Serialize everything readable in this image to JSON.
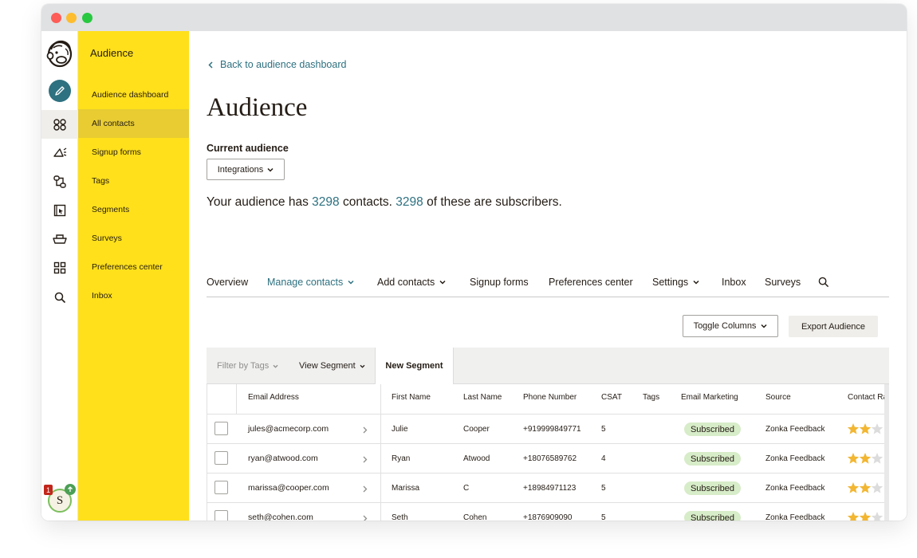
{
  "app": {
    "sidebar_title": "Audience",
    "avatar_initial": "S",
    "notification_count": "1"
  },
  "sidebar": {
    "items": [
      {
        "label": "Audience dashboard"
      },
      {
        "label": "All contacts"
      },
      {
        "label": "Signup forms"
      },
      {
        "label": "Tags"
      },
      {
        "label": "Segments"
      },
      {
        "label": "Surveys"
      },
      {
        "label": "Preferences center"
      },
      {
        "label": "Inbox"
      }
    ]
  },
  "header": {
    "back_link": "Back to audience dashboard",
    "title": "Audience",
    "current_audience_label": "Current audience",
    "audience_dropdown": "Integrations",
    "summary": {
      "prefix": "Your audience has ",
      "contacts": "3298",
      "middle": " contacts. ",
      "subscribers": "3298",
      "suffix": " of these are subscribers."
    }
  },
  "tabs": [
    {
      "label": "Overview"
    },
    {
      "label": "Manage contacts"
    },
    {
      "label": "Add contacts"
    },
    {
      "label": "Signup forms"
    },
    {
      "label": "Preferences center"
    },
    {
      "label": "Settings"
    },
    {
      "label": "Inbox"
    },
    {
      "label": "Surveys"
    }
  ],
  "actions": {
    "toggle_columns": "Toggle Columns",
    "export": "Export Audience"
  },
  "filters": {
    "filter_by_tags": "Filter by Tags",
    "view_segment": "View Segment",
    "new_segment": "New Segment"
  },
  "table": {
    "columns": [
      "Email Address",
      "First Name",
      "Last Name",
      "Phone Number",
      "CSAT",
      "Tags",
      "Email Marketing",
      "Source",
      "Contact Rat"
    ],
    "rows": [
      {
        "email": "jules@acmecorp.com",
        "first": "Julie",
        "last": "Cooper",
        "phone": "+919999849771",
        "csat": "5",
        "tags": "",
        "marketing": "Subscribed",
        "source": "Zonka Feedback",
        "rating": 2
      },
      {
        "email": "ryan@atwood.com",
        "first": "Ryan",
        "last": "Atwood",
        "phone": "+18076589762",
        "csat": "4",
        "tags": "",
        "marketing": "Subscribed",
        "source": "Zonka Feedback",
        "rating": 2
      },
      {
        "email": "marissa@cooper.com",
        "first": "Marissa",
        "last": "C",
        "phone": "+18984971123",
        "csat": "5",
        "tags": "",
        "marketing": "Subscribed",
        "source": "Zonka Feedback",
        "rating": 2
      },
      {
        "email": "seth@cohen.com",
        "first": "Seth",
        "last": "Cohen",
        "phone": "+1876909090",
        "csat": "5",
        "tags": "",
        "marketing": "Subscribed",
        "source": "Zonka Feedback",
        "rating": 2
      }
    ]
  },
  "colors": {
    "brand_yellow": "#ffe01b",
    "accent_teal": "#2e7180",
    "subscribed_green": "#d7ecc8",
    "star_gold": "#f2b632"
  }
}
